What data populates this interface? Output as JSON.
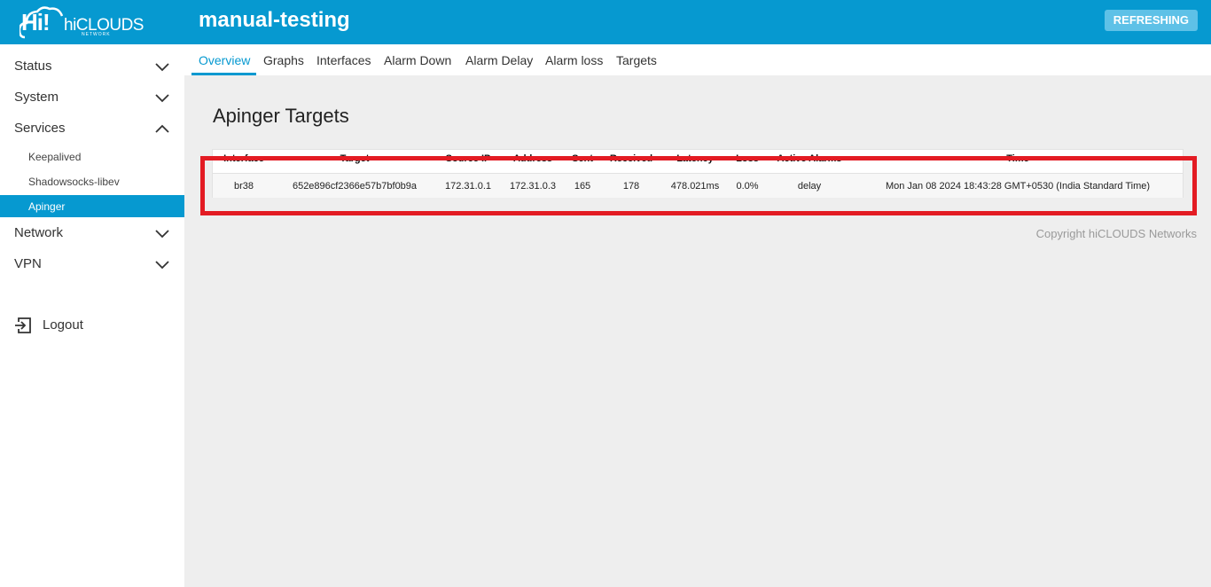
{
  "header": {
    "logo_hi": "Hi!",
    "logo_text": "hiCLOUDS",
    "logo_sub": "NETWORK",
    "hostname": "manual-testing",
    "refresh_label": "REFRESHING"
  },
  "sidebar": {
    "status": "Status",
    "system": "System",
    "services": "Services",
    "sub_items": [
      "Keepalived",
      "Shadowsocks-libev",
      "Apinger"
    ],
    "network": "Network",
    "vpn": "VPN",
    "logout": "Logout"
  },
  "tabs": [
    "Overview",
    "Graphs",
    "Interfaces",
    "Alarm Down",
    "Alarm Delay",
    "Alarm loss",
    "Targets"
  ],
  "page_title": "Apinger Targets",
  "table": {
    "headers": [
      "Interface",
      "Target",
      "Source IP",
      "Address",
      "Sent",
      "Received",
      "Latency",
      "Loss",
      "Active Alarms",
      "Time"
    ],
    "row": [
      "br38",
      "652e896cf2366e57b7bf0b9a",
      "172.31.0.1",
      "172.31.0.3",
      "165",
      "178",
      "478.021ms",
      "0.0%",
      "delay",
      "Mon Jan 08 2024 18:43:28 GMT+0530 (India Standard Time)"
    ]
  },
  "copyright": "Copyright hiCLOUDS Networks",
  "colors": {
    "accent": "#0699d0",
    "highlight": "#e31b23"
  }
}
